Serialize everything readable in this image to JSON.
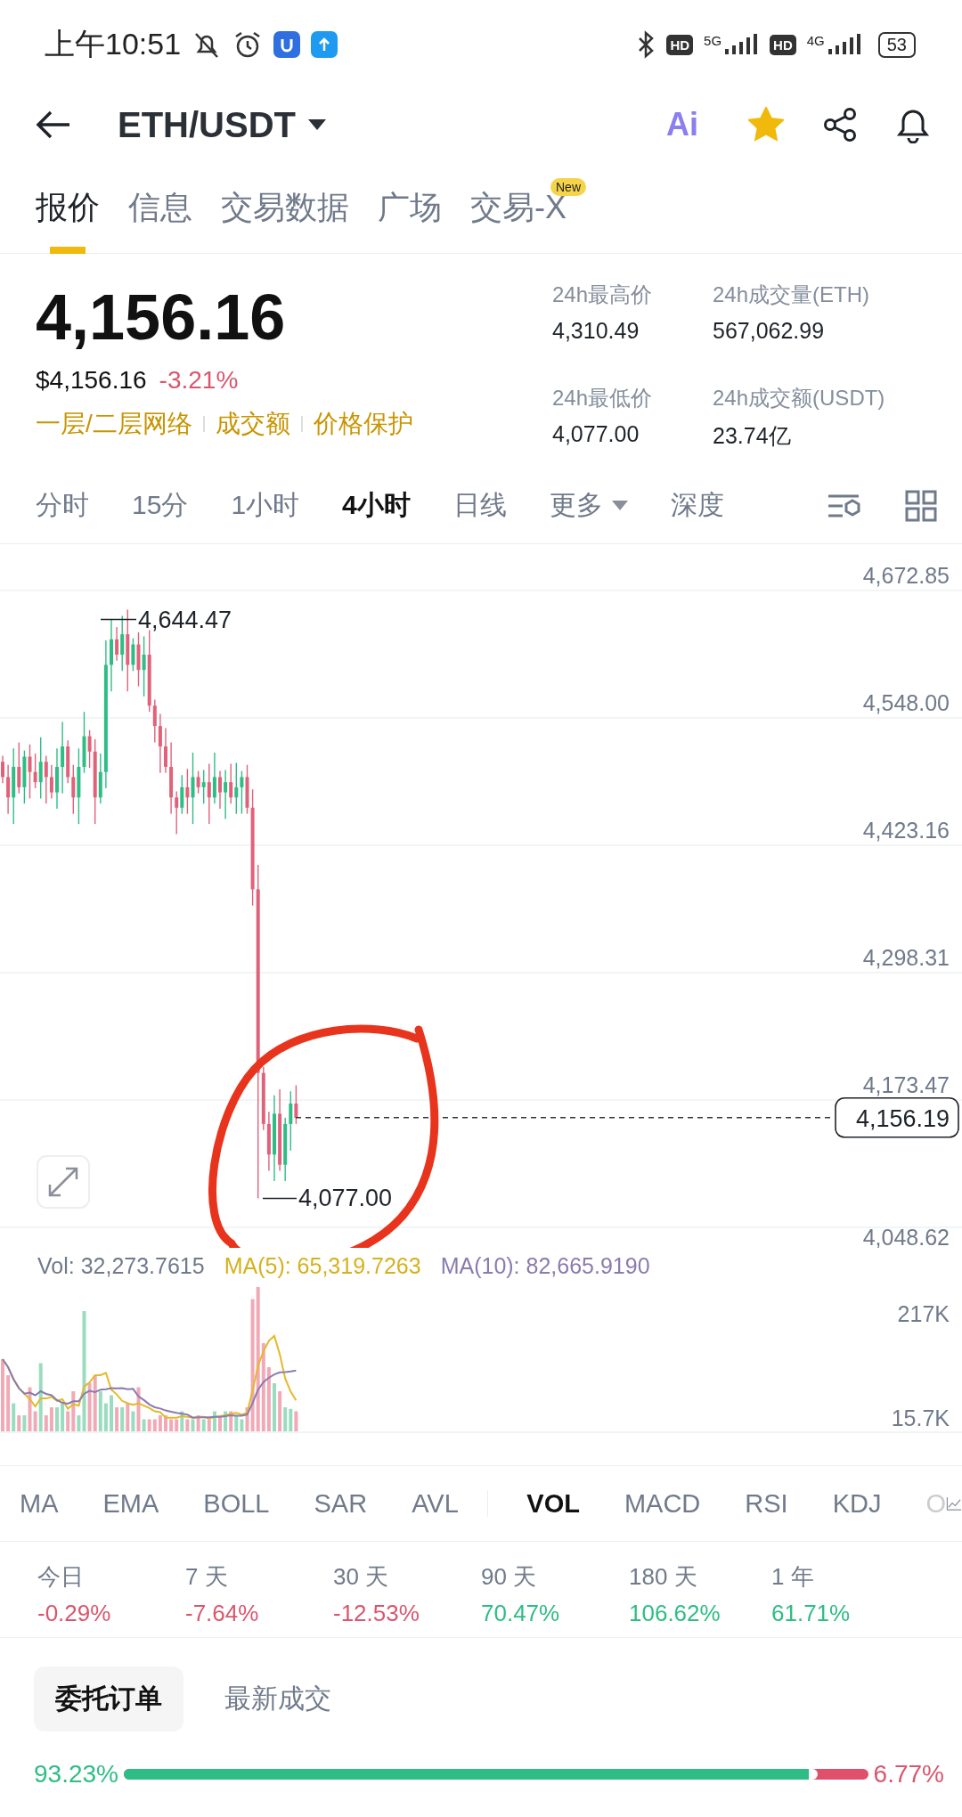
{
  "status_bar": {
    "time": "上午10:51",
    "sims": [
      {
        "hd": "HD",
        "network": "5G"
      },
      {
        "hd": "HD",
        "network": "4G"
      }
    ],
    "battery": "53"
  },
  "header": {
    "title": "ETH/USDT",
    "ai_label": "Ai",
    "favorite": true
  },
  "tabs": [
    {
      "label": "报价",
      "selected": true
    },
    {
      "label": "信息",
      "selected": false
    },
    {
      "label": "交易数据",
      "selected": false
    },
    {
      "label": "广场",
      "selected": false
    },
    {
      "label": "交易-X",
      "selected": false,
      "badge": "New"
    }
  ],
  "price": {
    "last": "4,156.16",
    "usd": "$4,156.16",
    "change": "-3.21%",
    "links": [
      "一层/二层网络",
      "成交额",
      "价格保护"
    ]
  },
  "stats": [
    {
      "label": "24h最高价",
      "value": "4,310.49"
    },
    {
      "label": "24h成交量(ETH)",
      "value": "567,062.99"
    },
    {
      "label": "24h最低价",
      "value": "4,077.00"
    },
    {
      "label": "24h成交额(USDT)",
      "value": "23.74亿"
    }
  ],
  "intervals": [
    {
      "label": "分时",
      "selected": false
    },
    {
      "label": "15分",
      "selected": false
    },
    {
      "label": "1小时",
      "selected": false
    },
    {
      "label": "4小时",
      "selected": true
    },
    {
      "label": "日线",
      "selected": false
    },
    {
      "label": "更多",
      "selected": false,
      "dropdown": true
    },
    {
      "label": "深度",
      "selected": false
    }
  ],
  "chart": {
    "price_ticks": [
      "4,672.85",
      "4,548.00",
      "4,423.16",
      "4,298.31",
      "4,173.47",
      "4,048.62"
    ],
    "high_label": "4,644.47",
    "low_label": "4,077.00",
    "last_label": "4,156.19"
  },
  "volume": {
    "vol": "Vol: 32,273.7615",
    "ma5": "MA(5): 65,319.7263",
    "ma10": "MA(10): 82,665.9190",
    "ticks": [
      "217K",
      "15.7K"
    ]
  },
  "indicators": [
    {
      "label": "MA",
      "selected": false
    },
    {
      "label": "EMA",
      "selected": false
    },
    {
      "label": "BOLL",
      "selected": false
    },
    {
      "label": "SAR",
      "selected": false
    },
    {
      "label": "AVL",
      "selected": false
    },
    {
      "label": "VOL",
      "selected": true
    },
    {
      "label": "MACD",
      "selected": false
    },
    {
      "label": "RSI",
      "selected": false
    },
    {
      "label": "KDJ",
      "selected": false
    },
    {
      "label": "O",
      "selected": false
    }
  ],
  "periods": [
    {
      "label": "今日",
      "value": "-0.29%",
      "color": "#d9566e"
    },
    {
      "label": "7 天",
      "value": "-7.64%",
      "color": "#d9566e"
    },
    {
      "label": "30 天",
      "value": "-12.53%",
      "color": "#d9566e"
    },
    {
      "label": "90 天",
      "value": "70.47%",
      "color": "#2ebd85"
    },
    {
      "label": "180 天",
      "value": "106.62%",
      "color": "#2ebd85"
    },
    {
      "label": "1 年",
      "value": "61.71%",
      "color": "#2ebd85"
    }
  ],
  "order_tabs": [
    {
      "label": "委托订单",
      "selected": true
    },
    {
      "label": "最新成交",
      "selected": false
    }
  ],
  "ratio": {
    "buy": "93.23%",
    "sell": "6.77%",
    "level": 0.9323
  }
}
